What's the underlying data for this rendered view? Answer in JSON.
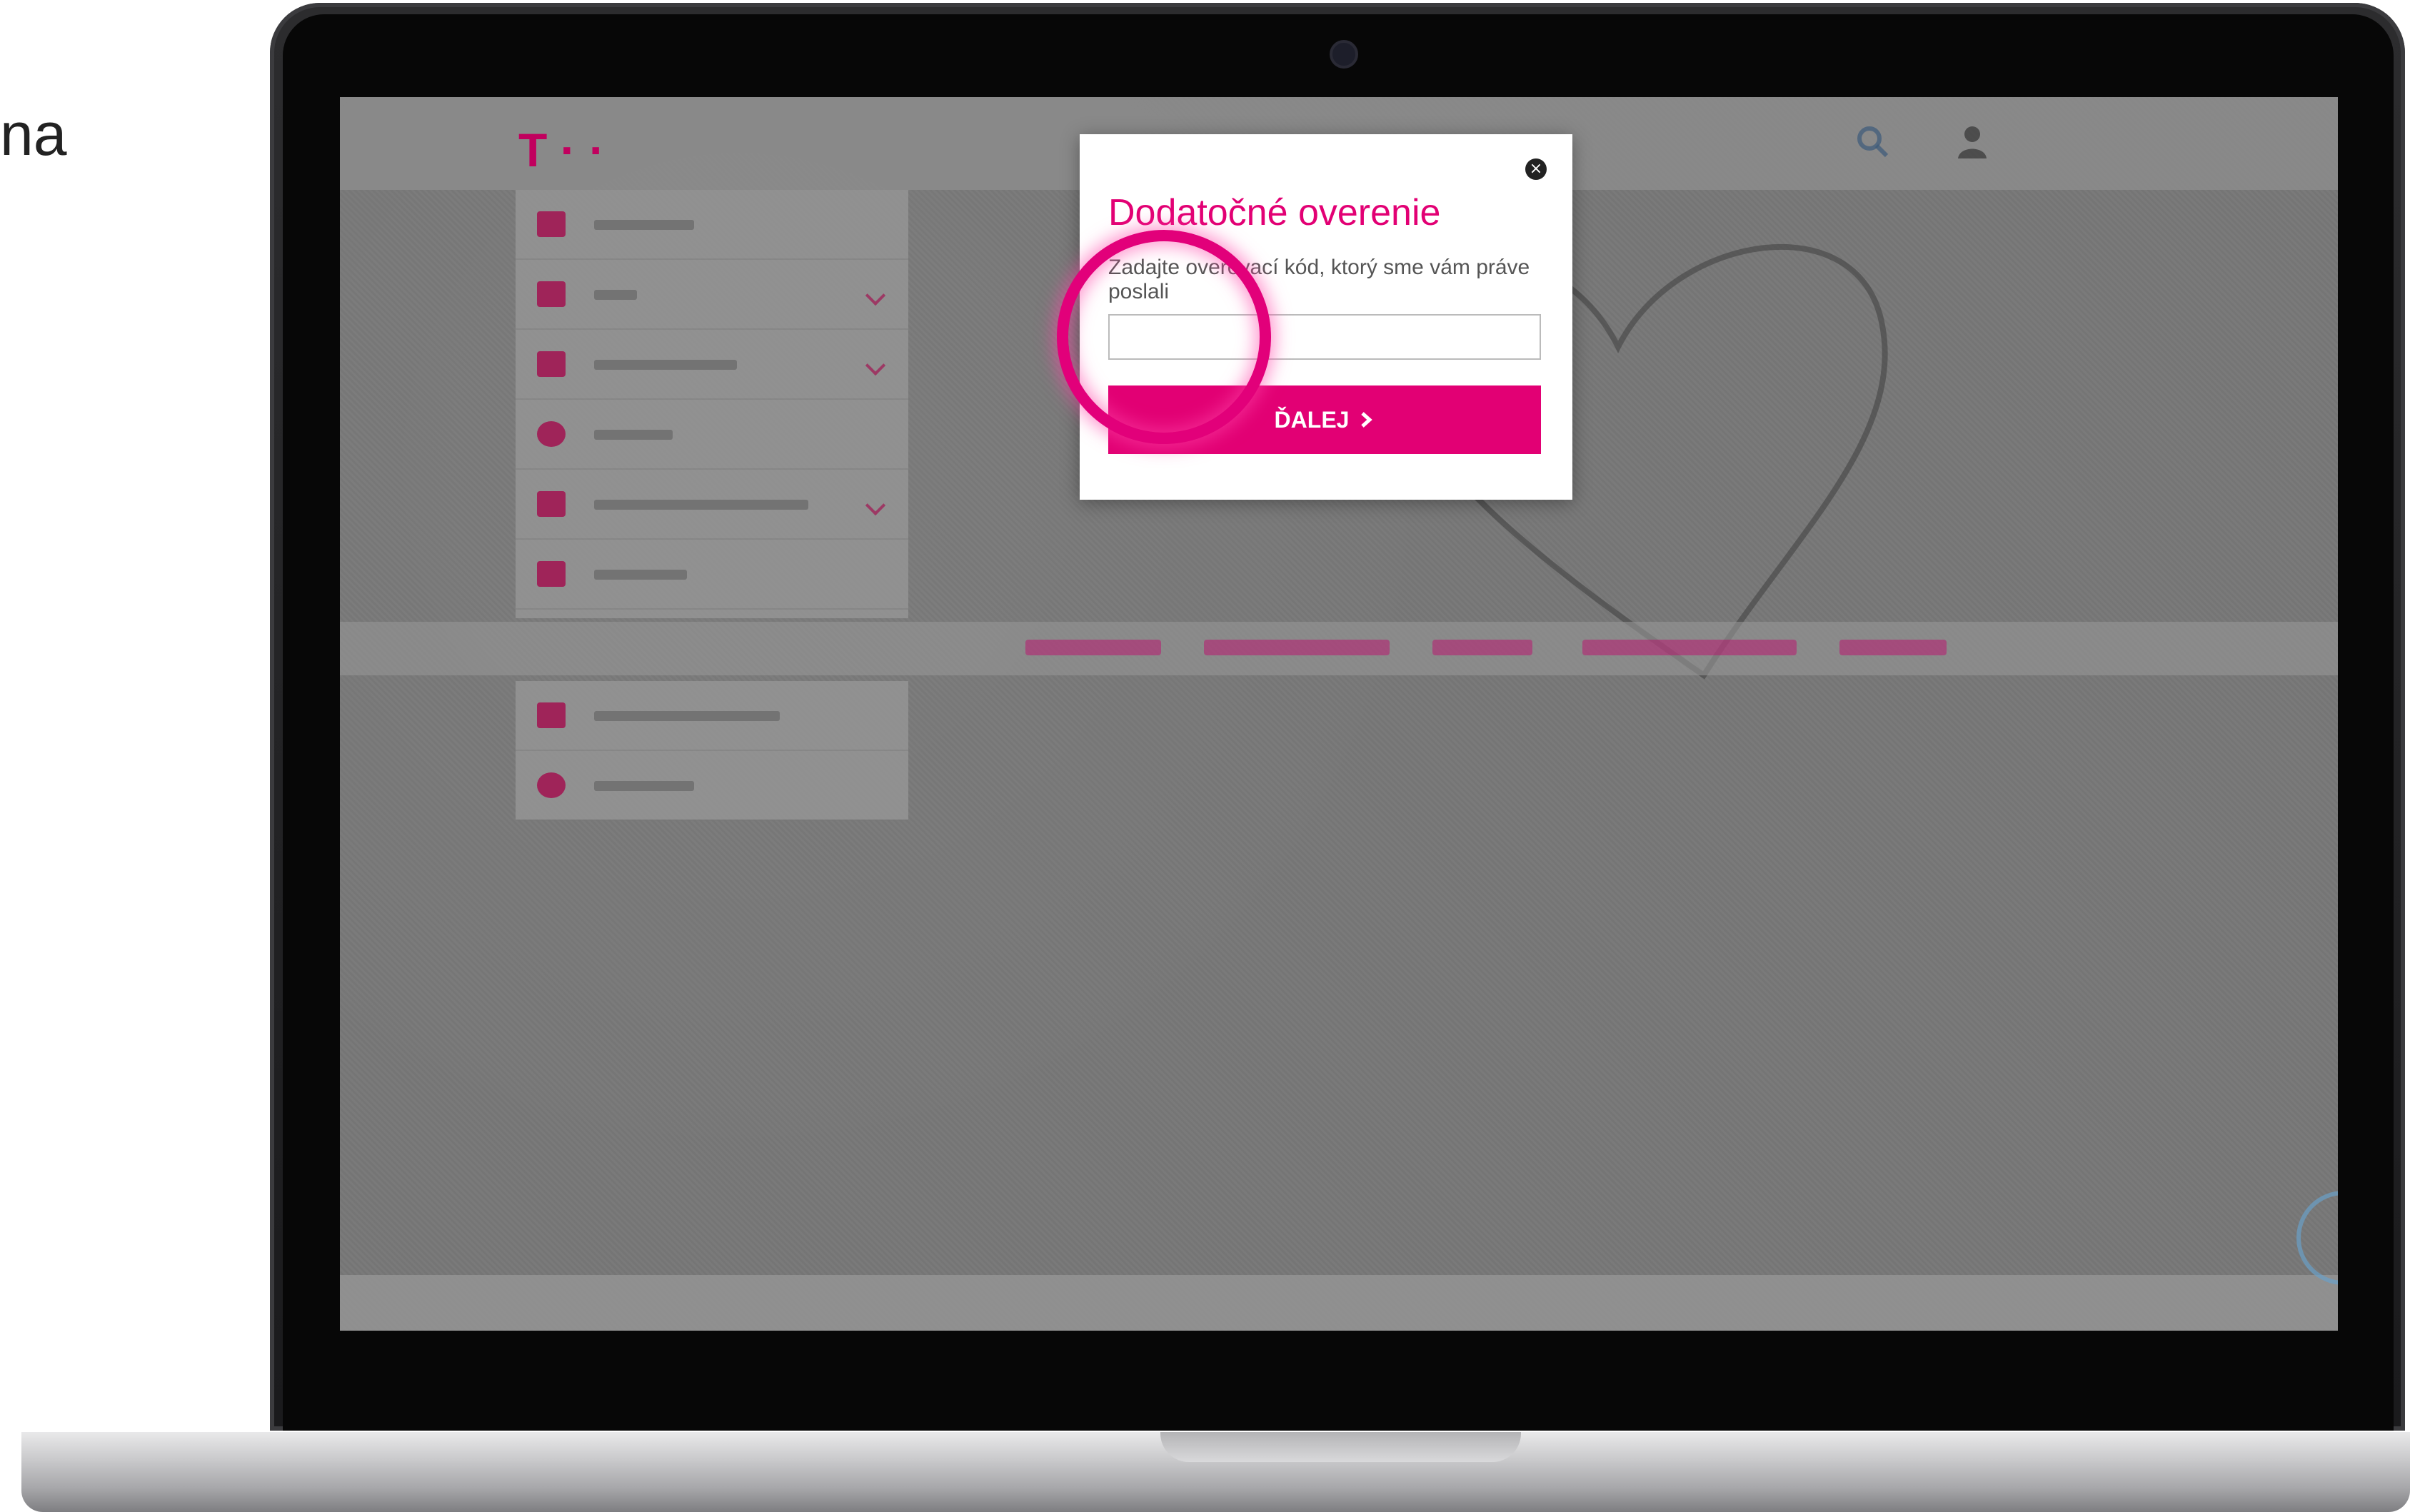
{
  "side_text": "na",
  "screen": {
    "colors": {
      "magenta": "#e20074",
      "dim_overlay": "#646464"
    },
    "header": {
      "logo": "T · ·",
      "lang_label": "",
      "user_label": ""
    },
    "modal": {
      "title": "Dodatočné overenie",
      "description": "Zadajte overovací kód, ktorý sme vám práve poslali",
      "input_value": "",
      "input_placeholder": "",
      "button_label": "ĎALEJ",
      "button_icon": "chevron-right-icon",
      "close_icon": "close-icon"
    }
  }
}
